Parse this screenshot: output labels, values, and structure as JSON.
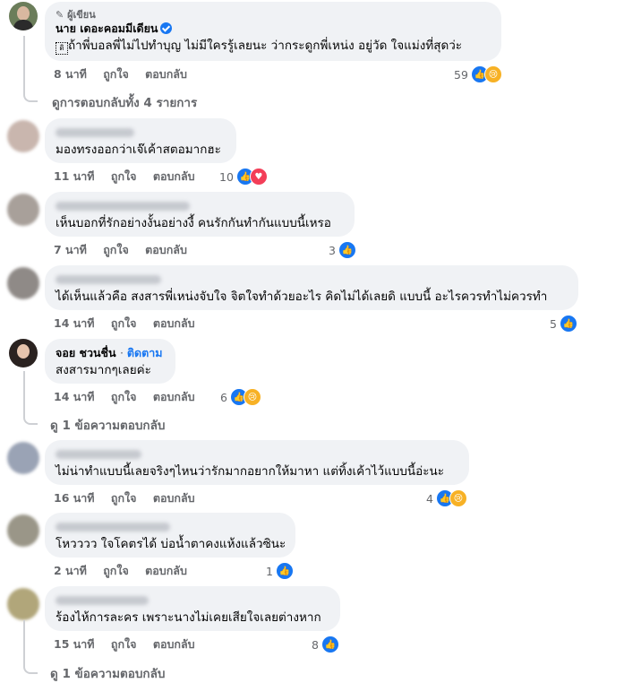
{
  "actions": {
    "like": "ถูกใจ",
    "reply": "ตอบกลับ"
  },
  "comments": [
    {
      "author_tag": "ผู้เขียน",
      "name": "นาย เดอะคอมมีเดียน",
      "text": "ถ้าพี่บอลพี่ไม่ไปทำบุญ ไม่มีใครรู้เลยนะ ว่ากระดูกพี่เหน่ง อยู่วัด ใจแม่งที่สุดว่ะ",
      "time": "8 นาที",
      "reactions": "59",
      "replies_link": "ดูการตอบกลับทั้ง 4 รายการ"
    },
    {
      "text": "มองทรงออกว่าเจ๊เค้าสตอมากฮะ",
      "time": "11 นาที",
      "reactions": "10"
    },
    {
      "text": "เห็นบอกที่รักอย่างงั้นอย่างงี้ คนรักกันทำกันแบบนี้เหรอ",
      "time": "7 นาที",
      "reactions": "3"
    },
    {
      "text": "ได้เห็นแล้วคือ สงสารพี่เหน่งจับใจ จิตใจทำด้วยอะไร คิดไม่ได้เลยดิ แบบนี้ อะไรควรทำไม่ควรทำ",
      "time": "14 นาที",
      "reactions": "5"
    },
    {
      "name": "จอย ชวนชื่น",
      "follow": "ติดตาม",
      "text": "สงสารมากๆเลยค่ะ",
      "time": "14 นาที",
      "reactions": "6",
      "replies_link": "ดู 1 ข้อความตอบกลับ"
    },
    {
      "text": "ไม่น่าทำแบบนี้เลยจริงๆไหนว่ารักมากอยากให้มาหา แต่ทิ้งเค้าไว้แบบนี้อ่ะนะ",
      "time": "16 นาที",
      "reactions": "4"
    },
    {
      "text": "โหวววว ใจโคตรได้ บ่อน้ำตาคงแห้งแล้วซินะ",
      "time": "2 นาที",
      "reactions": "1"
    },
    {
      "text": "ร้องไห้การละคร เพราะนางไม่เคยเสียใจเลยต่างหาก",
      "time": "15 นาที",
      "reactions": "8",
      "replies_link": "ดู 1 ข้อความตอบกลับ"
    }
  ]
}
